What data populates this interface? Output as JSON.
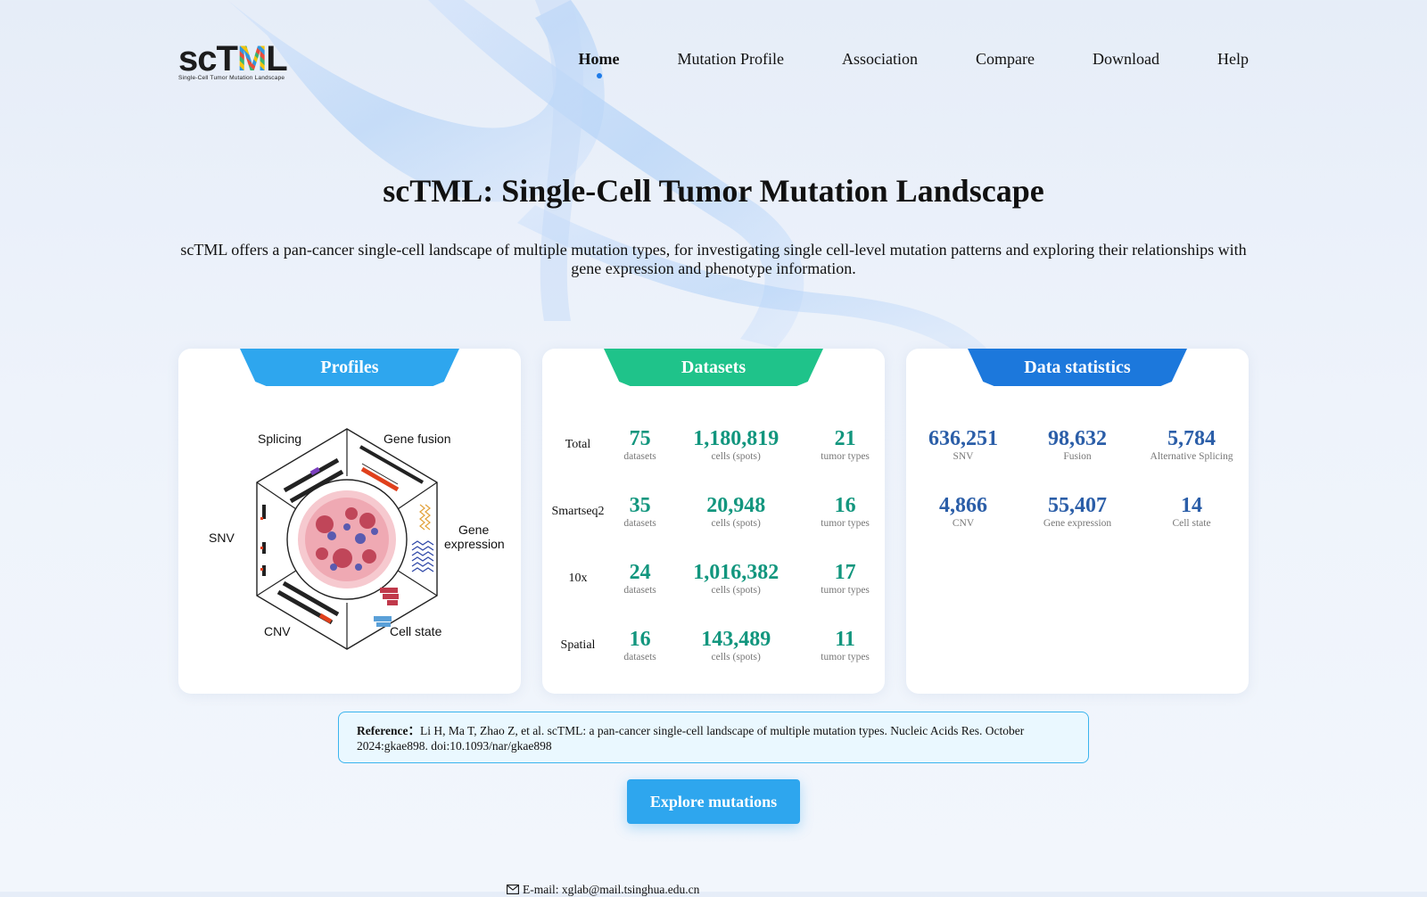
{
  "brand": {
    "name": "scTML",
    "name_sc": "sc",
    "name_t": "T",
    "name_m": "M",
    "name_l": "L",
    "subtitle": "Single-Cell Tumor Mutation Landscape"
  },
  "nav": [
    {
      "label": "Home",
      "active": true
    },
    {
      "label": "Mutation Profile"
    },
    {
      "label": "Association"
    },
    {
      "label": "Compare"
    },
    {
      "label": "Download"
    },
    {
      "label": "Help"
    }
  ],
  "hero": {
    "title": "scTML: Single-Cell Tumor Mutation Landscape",
    "description": "scTML offers a pan-cancer single-cell landscape of multiple mutation types, for investigating single cell-level mutation patterns and exploring their relationships with gene expression and phenotype information."
  },
  "profiles": {
    "title": "Profiles",
    "labels": {
      "splicing": "Splicing",
      "gene_fusion": "Gene fusion",
      "gene": "Gene",
      "expression": "expression",
      "snv": "SNV",
      "cnv": "CNV",
      "cell_state": "Cell state"
    }
  },
  "datasets": {
    "title": "Datasets",
    "rows": [
      {
        "label": "Total",
        "datasets": "75",
        "cells": "1,180,819",
        "tumors": "21"
      },
      {
        "label": "Smartseq2",
        "datasets": "35",
        "cells": "20,948",
        "tumors": "16"
      },
      {
        "label": "10x",
        "datasets": "24",
        "cells": "1,016,382",
        "tumors": "17"
      },
      {
        "label": "Spatial",
        "datasets": "16",
        "cells": "143,489",
        "tumors": "11"
      }
    ],
    "captions": {
      "datasets": "datasets",
      "cells": "cells (spots)",
      "tumors": "tumor types"
    }
  },
  "statistics": {
    "title": "Data statistics",
    "items": [
      {
        "value": "636,251",
        "label": "SNV"
      },
      {
        "value": "98,632",
        "label": "Fusion"
      },
      {
        "value": "5,784",
        "label": "Alternative Splicing"
      },
      {
        "value": "4,866",
        "label": "CNV"
      },
      {
        "value": "55,407",
        "label": "Gene expression"
      },
      {
        "value": "14",
        "label": "Cell state"
      }
    ]
  },
  "reference": {
    "label": "Reference：",
    "text": "Li H, Ma T, Zhao Z, et al. scTML: a pan-cancer single-cell landscape of multiple mutation types. Nucleic Acids Res. October 2024:gkae898. doi:10.1093/nar/gkae898"
  },
  "cta": {
    "label": "Explore mutations"
  },
  "footer": {
    "email": "E-mail: xglab@mail.tsinghua.edu.cn"
  },
  "colors": {
    "accent": "#2ea6ee",
    "green": "#1fc38a",
    "dark_blue": "#1c78dc",
    "number_teal": "#12967e",
    "number_blue": "#2b5ea8",
    "active_dot": "#1e7be8"
  },
  "icons": {
    "email": "mail-icon"
  }
}
